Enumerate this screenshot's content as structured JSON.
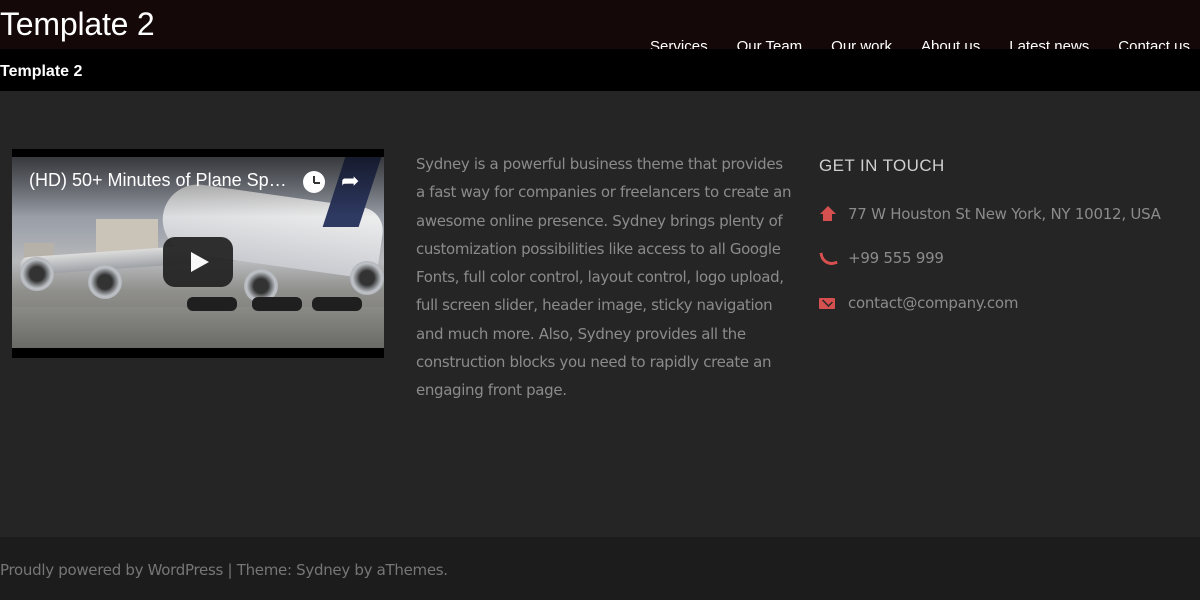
{
  "header": {
    "site_title": "Template 2",
    "nav": [
      "Services",
      "Our Team",
      "Our work",
      "About us",
      "Latest news",
      "Contact us"
    ]
  },
  "page": {
    "heading": "Template 2"
  },
  "video": {
    "title": "(HD) 50+ Minutes of Plane Sp…",
    "icons": [
      "clock-icon",
      "share-icon",
      "play-icon"
    ]
  },
  "main": {
    "description": "Sydney is a powerful business theme that provides a fast way for companies or freelancers to create an awesome online presence. Sydney brings plenty of customization possibilities like access to all Google Fonts, full color control, layout control, logo upload, full screen slider, header image, sticky navigation and much more. Also, Sydney provides all the construction blocks you need to rapidly create an engaging front page."
  },
  "contact": {
    "title": "GET IN TOUCH",
    "address": "77 W Houston St New York, NY 10012, USA",
    "phone": "+99 555 999",
    "email": "contact@company.com"
  },
  "footer": {
    "powered_text": "Proudly powered by WordPress",
    "separator": " | ",
    "theme_text": "Theme: ",
    "theme_link": "Sydney",
    "by_text": " by aThemes."
  },
  "colors": {
    "accent": "#d65050",
    "background": "#252525",
    "header": "#140808"
  }
}
